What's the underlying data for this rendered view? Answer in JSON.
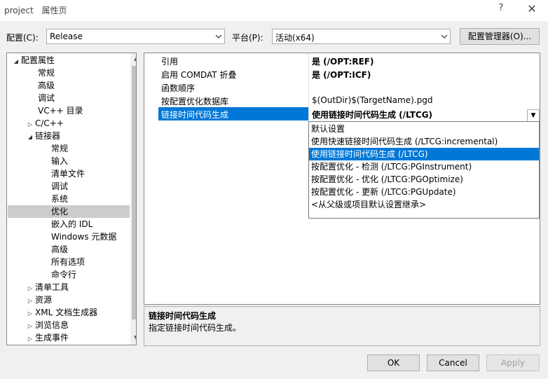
{
  "window": {
    "title_project": "project",
    "title_page": "属性页",
    "help_glyph": "?",
    "close_glyph": "✕"
  },
  "config_row": {
    "config_label": "配置(C):",
    "config_value": "Release",
    "platform_label": "平台(P):",
    "platform_value": "活动(x64)",
    "manager_button": "配置管理器(O)..."
  },
  "tree": {
    "items": [
      {
        "label": "配置属性",
        "expander": "◢"
      },
      {
        "label": "常规"
      },
      {
        "label": "高级"
      },
      {
        "label": "调试"
      },
      {
        "label": "VC++ 目录"
      },
      {
        "label": "C/C++",
        "expander": "▷"
      },
      {
        "label": "链接器",
        "expander": "◢"
      },
      {
        "label": "常规"
      },
      {
        "label": "输入"
      },
      {
        "label": "清单文件"
      },
      {
        "label": "调试"
      },
      {
        "label": "系统"
      },
      {
        "label": "优化",
        "selected": true
      },
      {
        "label": "嵌入的 IDL"
      },
      {
        "label": "Windows 元数据"
      },
      {
        "label": "高级"
      },
      {
        "label": "所有选项"
      },
      {
        "label": "命令行"
      },
      {
        "label": "清单工具",
        "expander": "▷"
      },
      {
        "label": "资源",
        "expander": "▷"
      },
      {
        "label": "XML 文档生成器",
        "expander": "▷"
      },
      {
        "label": "浏览信息",
        "expander": "▷"
      },
      {
        "label": "生成事件",
        "expander": "▷"
      }
    ]
  },
  "grid": {
    "rows": [
      {
        "name": "引用",
        "value": "是 (/OPT:REF)",
        "bold": true
      },
      {
        "name": "启用 COMDAT 折叠",
        "value": "是 (/OPT:ICF)",
        "bold": true
      },
      {
        "name": "函数顺序",
        "value": ""
      },
      {
        "name": "按配置优化数据库",
        "value": "$(OutDir)$(TargetName).pgd"
      },
      {
        "name": "链接时间代码生成",
        "value": "使用链接时间代码生成 (/LTCG)",
        "bold": true,
        "active": true
      }
    ]
  },
  "dropdown": {
    "options": [
      "默认设置",
      "使用快速链接时间代码生成 (/LTCG:incremental)",
      "使用链接时间代码生成 (/LTCG)",
      "按配置优化 - 检测 (/LTCG:PGInstrument)",
      "按配置优化 - 优化 (/LTCG:PGOptimize)",
      "按配置优化 - 更新 (/LTCG:PGUpdate)",
      "<从父级或项目默认设置继承>"
    ],
    "selected_index": 2
  },
  "description": {
    "title": "链接时间代码生成",
    "text": "指定链接时间代码生成。"
  },
  "buttons": {
    "ok": "OK",
    "cancel": "Cancel",
    "apply": "Apply"
  },
  "colors": {
    "accent": "#0078d7",
    "tree_selected": "#cccccc",
    "background": "#f0f0f0"
  }
}
